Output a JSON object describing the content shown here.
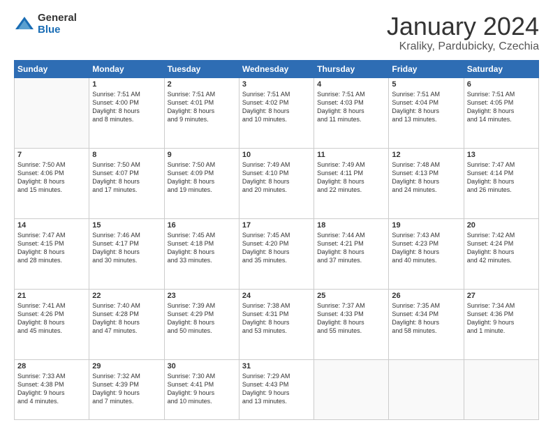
{
  "logo": {
    "general": "General",
    "blue": "Blue"
  },
  "header": {
    "month": "January 2024",
    "location": "Kraliky, Pardubicky, Czechia"
  },
  "weekdays": [
    "Sunday",
    "Monday",
    "Tuesday",
    "Wednesday",
    "Thursday",
    "Friday",
    "Saturday"
  ],
  "weeks": [
    [
      {
        "day": "",
        "info": ""
      },
      {
        "day": "1",
        "info": "Sunrise: 7:51 AM\nSunset: 4:00 PM\nDaylight: 8 hours\nand 8 minutes."
      },
      {
        "day": "2",
        "info": "Sunrise: 7:51 AM\nSunset: 4:01 PM\nDaylight: 8 hours\nand 9 minutes."
      },
      {
        "day": "3",
        "info": "Sunrise: 7:51 AM\nSunset: 4:02 PM\nDaylight: 8 hours\nand 10 minutes."
      },
      {
        "day": "4",
        "info": "Sunrise: 7:51 AM\nSunset: 4:03 PM\nDaylight: 8 hours\nand 11 minutes."
      },
      {
        "day": "5",
        "info": "Sunrise: 7:51 AM\nSunset: 4:04 PM\nDaylight: 8 hours\nand 13 minutes."
      },
      {
        "day": "6",
        "info": "Sunrise: 7:51 AM\nSunset: 4:05 PM\nDaylight: 8 hours\nand 14 minutes."
      }
    ],
    [
      {
        "day": "7",
        "info": "Sunrise: 7:50 AM\nSunset: 4:06 PM\nDaylight: 8 hours\nand 15 minutes."
      },
      {
        "day": "8",
        "info": "Sunrise: 7:50 AM\nSunset: 4:07 PM\nDaylight: 8 hours\nand 17 minutes."
      },
      {
        "day": "9",
        "info": "Sunrise: 7:50 AM\nSunset: 4:09 PM\nDaylight: 8 hours\nand 19 minutes."
      },
      {
        "day": "10",
        "info": "Sunrise: 7:49 AM\nSunset: 4:10 PM\nDaylight: 8 hours\nand 20 minutes."
      },
      {
        "day": "11",
        "info": "Sunrise: 7:49 AM\nSunset: 4:11 PM\nDaylight: 8 hours\nand 22 minutes."
      },
      {
        "day": "12",
        "info": "Sunrise: 7:48 AM\nSunset: 4:13 PM\nDaylight: 8 hours\nand 24 minutes."
      },
      {
        "day": "13",
        "info": "Sunrise: 7:47 AM\nSunset: 4:14 PM\nDaylight: 8 hours\nand 26 minutes."
      }
    ],
    [
      {
        "day": "14",
        "info": "Sunrise: 7:47 AM\nSunset: 4:15 PM\nDaylight: 8 hours\nand 28 minutes."
      },
      {
        "day": "15",
        "info": "Sunrise: 7:46 AM\nSunset: 4:17 PM\nDaylight: 8 hours\nand 30 minutes."
      },
      {
        "day": "16",
        "info": "Sunrise: 7:45 AM\nSunset: 4:18 PM\nDaylight: 8 hours\nand 33 minutes."
      },
      {
        "day": "17",
        "info": "Sunrise: 7:45 AM\nSunset: 4:20 PM\nDaylight: 8 hours\nand 35 minutes."
      },
      {
        "day": "18",
        "info": "Sunrise: 7:44 AM\nSunset: 4:21 PM\nDaylight: 8 hours\nand 37 minutes."
      },
      {
        "day": "19",
        "info": "Sunrise: 7:43 AM\nSunset: 4:23 PM\nDaylight: 8 hours\nand 40 minutes."
      },
      {
        "day": "20",
        "info": "Sunrise: 7:42 AM\nSunset: 4:24 PM\nDaylight: 8 hours\nand 42 minutes."
      }
    ],
    [
      {
        "day": "21",
        "info": "Sunrise: 7:41 AM\nSunset: 4:26 PM\nDaylight: 8 hours\nand 45 minutes."
      },
      {
        "day": "22",
        "info": "Sunrise: 7:40 AM\nSunset: 4:28 PM\nDaylight: 8 hours\nand 47 minutes."
      },
      {
        "day": "23",
        "info": "Sunrise: 7:39 AM\nSunset: 4:29 PM\nDaylight: 8 hours\nand 50 minutes."
      },
      {
        "day": "24",
        "info": "Sunrise: 7:38 AM\nSunset: 4:31 PM\nDaylight: 8 hours\nand 53 minutes."
      },
      {
        "day": "25",
        "info": "Sunrise: 7:37 AM\nSunset: 4:33 PM\nDaylight: 8 hours\nand 55 minutes."
      },
      {
        "day": "26",
        "info": "Sunrise: 7:35 AM\nSunset: 4:34 PM\nDaylight: 8 hours\nand 58 minutes."
      },
      {
        "day": "27",
        "info": "Sunrise: 7:34 AM\nSunset: 4:36 PM\nDaylight: 9 hours\nand 1 minute."
      }
    ],
    [
      {
        "day": "28",
        "info": "Sunrise: 7:33 AM\nSunset: 4:38 PM\nDaylight: 9 hours\nand 4 minutes."
      },
      {
        "day": "29",
        "info": "Sunrise: 7:32 AM\nSunset: 4:39 PM\nDaylight: 9 hours\nand 7 minutes."
      },
      {
        "day": "30",
        "info": "Sunrise: 7:30 AM\nSunset: 4:41 PM\nDaylight: 9 hours\nand 10 minutes."
      },
      {
        "day": "31",
        "info": "Sunrise: 7:29 AM\nSunset: 4:43 PM\nDaylight: 9 hours\nand 13 minutes."
      },
      {
        "day": "",
        "info": ""
      },
      {
        "day": "",
        "info": ""
      },
      {
        "day": "",
        "info": ""
      }
    ]
  ]
}
